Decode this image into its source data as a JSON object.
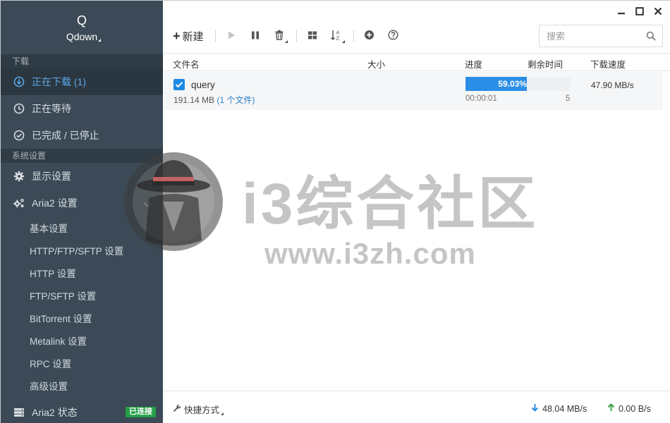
{
  "app": {
    "logo_letter": "Q",
    "name": "Qdown"
  },
  "sidebar": {
    "section_download": "下载",
    "download_items": [
      {
        "label": "正在下载 (1)",
        "icon": "arrow-down-circle-icon",
        "active": true
      },
      {
        "label": "正在等待",
        "icon": "clock-icon",
        "active": false
      },
      {
        "label": "已完成 / 已停止",
        "icon": "check-circle-icon",
        "active": false
      }
    ],
    "section_settings": "系统设置",
    "settings_items": [
      {
        "label": "显示设置",
        "icon": "gear-icon"
      },
      {
        "label": "Aria2 设置",
        "icon": "gears-icon"
      }
    ],
    "aria2_sub_items": [
      "基本设置",
      "HTTP/FTP/SFTP 设置",
      "HTTP 设置",
      "FTP/SFTP 设置",
      "BitTorrent 设置",
      "Metalink 设置",
      "RPC 设置",
      "高级设置"
    ],
    "status": {
      "label": "Aria2 状态",
      "badge": "已连接",
      "badge_color": "#22a046"
    }
  },
  "toolbar": {
    "new_label": "新建",
    "search_placeholder": "搜索"
  },
  "columns": {
    "name": "文件名",
    "size": "大小",
    "progress": "进度",
    "remaining": "剩余时间",
    "speed": "下载速度"
  },
  "tasks": [
    {
      "name": "query",
      "size": "191.14 MB",
      "files": "(1 个文件)",
      "progress_text": "59.03%",
      "progress": 0.5903,
      "elapsed": "00:00:01",
      "connections": "5",
      "speed": "47.90 MB/s"
    }
  ],
  "footer": {
    "shortcut_label": "快捷方式",
    "download_speed": "48.04 MB/s",
    "upload_speed": "0.00 B/s"
  },
  "watermark": {
    "title": "i3综合社区",
    "url": "www.i3zh.com"
  },
  "colors": {
    "sidebar_bg": "#3b4a56",
    "accent": "#2b8ee6",
    "active_text": "#5ca6e8",
    "download_arrow": "#2b8ee6",
    "upload_arrow": "#3aa043"
  }
}
